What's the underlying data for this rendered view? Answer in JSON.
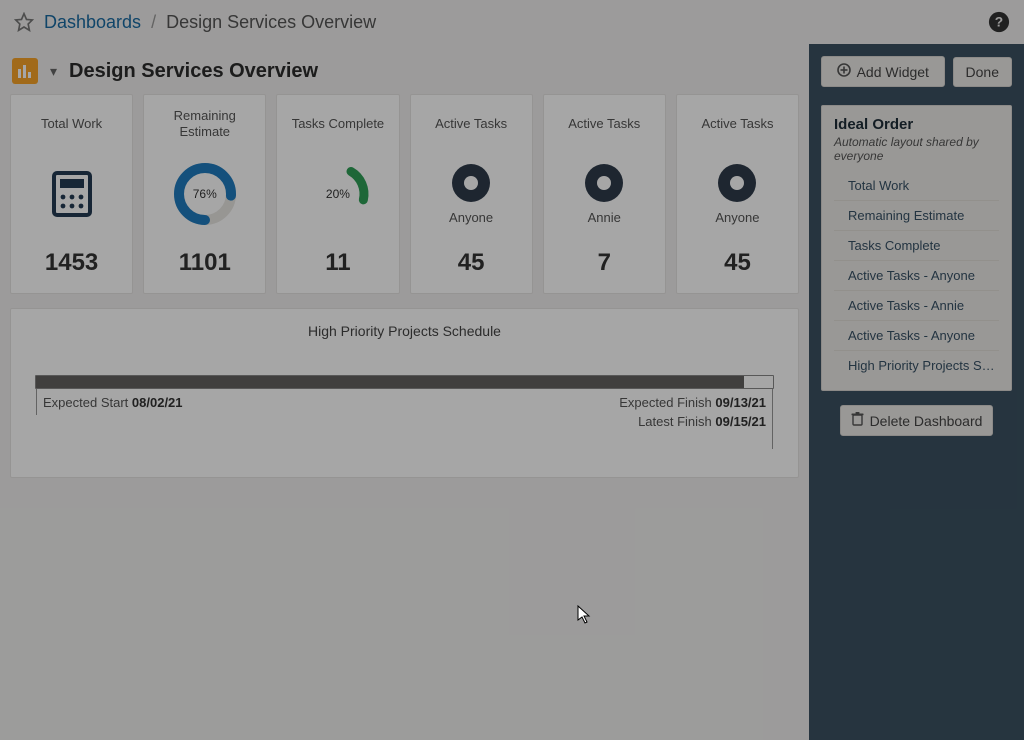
{
  "breadcrumb": {
    "root": "Dashboards",
    "current": "Design Services Overview"
  },
  "dashboard": {
    "title": "Design Services Overview"
  },
  "cards": {
    "total_work": {
      "title": "Total Work",
      "value": "1453"
    },
    "remaining": {
      "title": "Remaining Estimate",
      "percent": "76%",
      "value": "1101"
    },
    "tasks_done": {
      "title": "Tasks Complete",
      "percent": "20%",
      "value": "11"
    },
    "active1": {
      "title": "Active Tasks",
      "who": "Anyone",
      "value": "45"
    },
    "active2": {
      "title": "Active Tasks",
      "who": "Annie",
      "value": "7"
    },
    "active3": {
      "title": "Active Tasks",
      "who": "Anyone",
      "value": "45"
    }
  },
  "schedule": {
    "title": "High Priority Projects Schedule",
    "expected_start_label": "Expected Start",
    "expected_start_date": "08/02/21",
    "expected_finish_label": "Expected Finish",
    "expected_finish_date": "09/13/21",
    "latest_finish_label": "Latest Finish",
    "latest_finish_date": "09/15/21"
  },
  "sidebar": {
    "add_widget": "Add Widget",
    "done": "Done",
    "ideal_title": "Ideal Order",
    "ideal_sub": "Automatic layout shared by everyone",
    "items": [
      "Total Work",
      "Remaining Estimate",
      "Tasks Complete",
      "Active Tasks - Anyone",
      "Active Tasks - Annie",
      "Active Tasks - Anyone",
      "High Priority Projects S…"
    ],
    "delete": "Delete Dashboard"
  },
  "colors": {
    "accent_orange": "#f7a428",
    "accent_blue": "#1a6aa2",
    "donut_blue": "#1f7bbf",
    "donut_green": "#2f9e56",
    "panel": "#3b5161"
  }
}
